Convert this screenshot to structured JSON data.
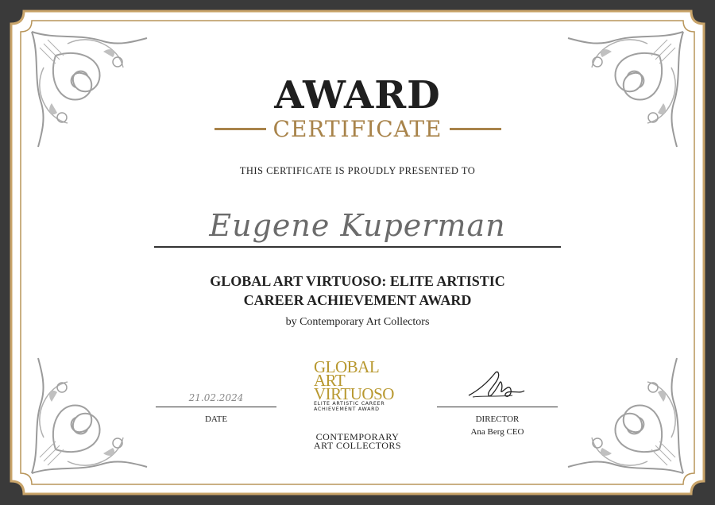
{
  "certificate": {
    "title": "AWARD",
    "subtitle": "CERTIFICATE",
    "presented_text": "THIS CERTIFICATE IS PROUDLY PRESENTED TO",
    "recipient_name": "Eugene Kuperman",
    "award_title_line1": "GLOBAL ART VIRTUOSO: ELITE ARTISTIC",
    "award_title_line2": "CAREER ACHIEVEMENT AWARD",
    "presented_by": "by Contemporary Art Collectors"
  },
  "date": {
    "value": "21.02.2024",
    "label": "DATE"
  },
  "logo": {
    "line1": "GLOBAL",
    "line2": "ART",
    "line3": "VIRTUOSO",
    "sub_line1": "ELITE ARTISTIC CAREER",
    "sub_line2": "ACHIEVEMENT AWARD"
  },
  "organization": {
    "line1": "CONTEMPORARY",
    "line2": "ART COLLECTORS"
  },
  "director": {
    "label": "DIRECTOR",
    "name": "Ana Berg CEO"
  },
  "colors": {
    "gold": "#a8834a",
    "border_dark": "#3a3a3a",
    "paper": "#ffffff",
    "ornament": "#9a9a9a"
  }
}
